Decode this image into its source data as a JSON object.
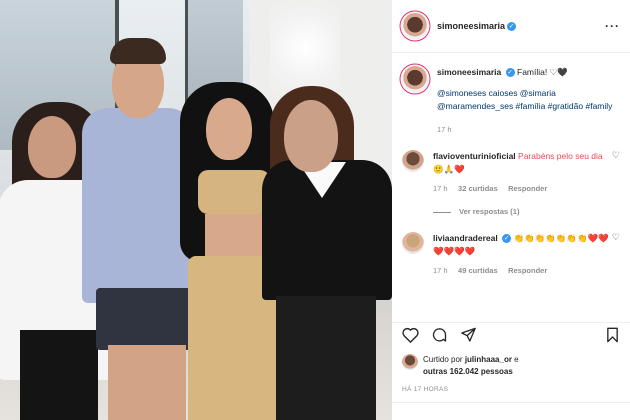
{
  "post": {
    "username": "simoneesimaria",
    "more_icon": "ellipsis-icon",
    "caption_main": "Família! ♡🖤",
    "caption_tags": "@simoneses caioses @simaria @maramendes_ses #família #gratidão #family",
    "caption_time": "17 h"
  },
  "comments": [
    {
      "username": "flavioventurinioficial",
      "text": "Parabéns pelo seu dia 🙂🙏❤️",
      "time": "17 h",
      "likes": "32 curtidas",
      "reply": "Responder",
      "view_replies": "Ver respostas (1)"
    },
    {
      "username": "liviaandradereal",
      "text": "👏👏👏👏👏👏👏❤️❤️❤️❤️❤️❤️",
      "time": "17 h",
      "likes": "49 curtidas",
      "reply": "Responder"
    }
  ],
  "actions": {
    "like_icon": "heart-icon",
    "comment_icon": "comment-icon",
    "share_icon": "share-icon",
    "save_icon": "bookmark-icon"
  },
  "likes_line": {
    "prefix": "Curtido por",
    "user": "julinhaaa_or",
    "middle": "e",
    "others": "outras 162.042 pessoas"
  },
  "posted_ago": "HÁ 17 HORAS",
  "colors": {
    "verified": "#3897f0",
    "link": "#00376b",
    "meta": "#8e8e8e"
  }
}
